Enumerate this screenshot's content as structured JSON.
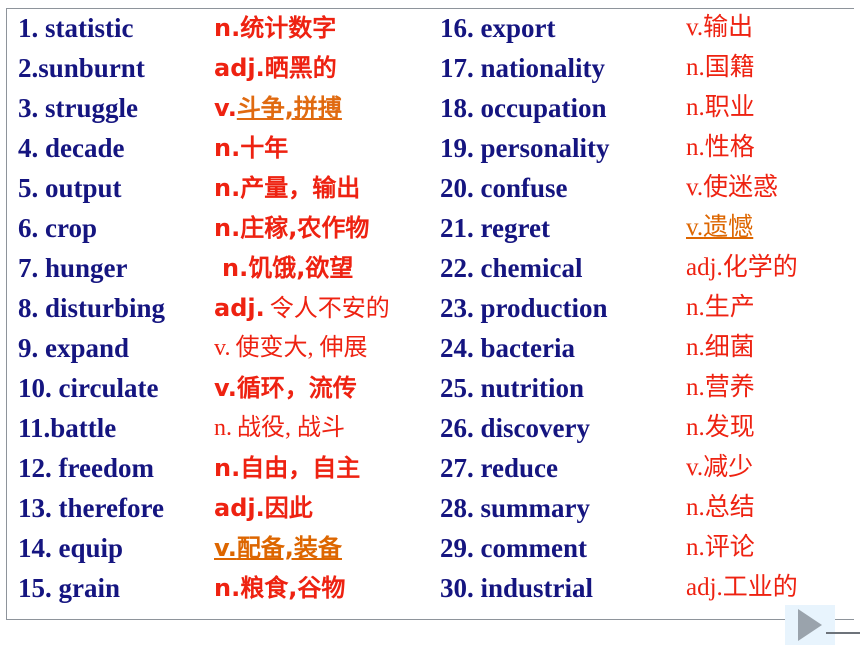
{
  "slide": {
    "colors": {
      "word_navy": "#151580",
      "definition_red": "#ee2211",
      "highlight_orange": "#dd6600",
      "frame_gray": "#8e949b",
      "nav_button_bg": "#e8f4fd",
      "nav_triangle": "#9aa3ac",
      "page_background": "#ffffff"
    }
  },
  "vocabulary": {
    "left_words": [
      "1. statistic",
      "2.sunburnt",
      "3. struggle",
      "4. decade",
      "5. output",
      "6. crop",
      "7. hunger",
      "8. disturbing",
      "9. expand",
      "10. circulate",
      "11.battle",
      "12. freedom",
      "13. therefore",
      "14. equip",
      "15. grain"
    ],
    "left_definitions": [
      {
        "pos": "n.",
        "cn": "统计数字",
        "style": "normal"
      },
      {
        "pos": "adj.",
        "cn": "晒黑的",
        "style": "normal"
      },
      {
        "pos": "v.",
        "cn": "斗争,拼搏",
        "style": "cn-orange-underline"
      },
      {
        "pos": "n.",
        "cn": "十年",
        "style": "normal"
      },
      {
        "pos": "n.",
        "cn": "产量，输出",
        "style": "normal"
      },
      {
        "pos": "n.",
        "cn": "庄稼,农作物",
        "style": "normal"
      },
      {
        "pos": "n.",
        "cn": "饥饿,欲望",
        "style": "indent"
      },
      {
        "pos": "adj.",
        "cn": "令人不安的",
        "style": "light-cn"
      },
      {
        "pos": "v.",
        "cn": "使变大, 伸展",
        "style": "light-serif"
      },
      {
        "pos": "v.",
        "cn": "循环，流传",
        "style": "normal"
      },
      {
        "pos": "n.",
        "cn": "战役, 战斗",
        "style": "light-serif"
      },
      {
        "pos": "n.",
        "cn": "自由，自主",
        "style": "normal"
      },
      {
        "pos": "adj.",
        "cn": "因此",
        "style": "normal"
      },
      {
        "pos": "v.",
        "cn": "配备,装备",
        "style": "all-orange-underline"
      },
      {
        "pos": "n.",
        "cn": "粮食,谷物",
        "style": "normal"
      }
    ],
    "right_words": [
      "16. export",
      "17. nationality",
      "18. occupation",
      "19. personality",
      "20. confuse",
      "21. regret",
      "22. chemical",
      "23. production",
      "24. bacteria",
      "25. nutrition",
      "26. discovery",
      "27. reduce",
      "28. summary",
      "29. comment",
      "30. industrial"
    ],
    "right_definitions": [
      {
        "pos": "v.",
        "cn": "输出",
        "style": "normal"
      },
      {
        "pos": "n.",
        "cn": "国籍",
        "style": "normal"
      },
      {
        "pos": "n.",
        "cn": "职业",
        "style": "normal"
      },
      {
        "pos": "n.",
        "cn": "性格",
        "style": "normal"
      },
      {
        "pos": "v.",
        "cn": "使迷惑",
        "style": "normal"
      },
      {
        "pos": "v.",
        "cn": "遗憾",
        "style": "all-orange-underline"
      },
      {
        "pos": "adj.",
        "cn": "化学的",
        "style": "normal"
      },
      {
        "pos": "n.",
        "cn": "生产",
        "style": "normal"
      },
      {
        "pos": "n.",
        "cn": "细菌",
        "style": "normal"
      },
      {
        "pos": "n.",
        "cn": "营养",
        "style": "normal"
      },
      {
        "pos": "n.",
        "cn": "发现",
        "style": "normal"
      },
      {
        "pos": "v.",
        "cn": "减少",
        "style": "normal"
      },
      {
        "pos": "n.",
        "cn": "总结",
        "style": "normal"
      },
      {
        "pos": "n.",
        "cn": "评论",
        "style": "normal"
      },
      {
        "pos": "adj.",
        "cn": "工业的",
        "style": "normal"
      }
    ]
  },
  "navigation": {
    "next_icon": "play-triangle-icon",
    "next_label": ""
  }
}
